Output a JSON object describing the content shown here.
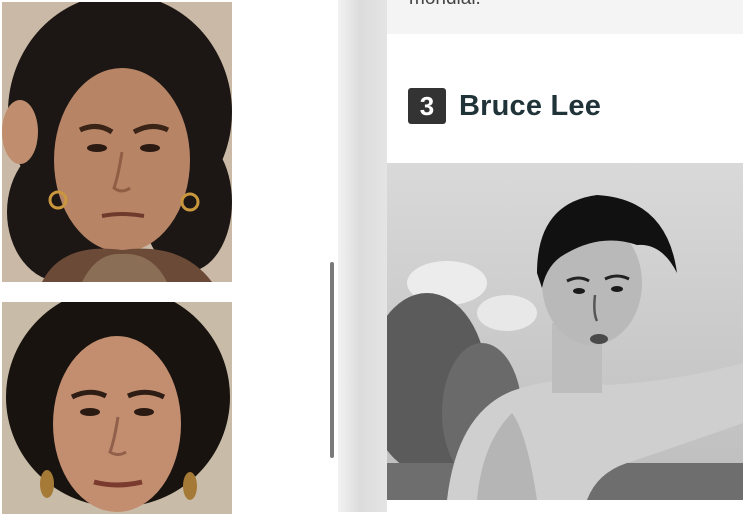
{
  "left_column": {
    "photos": [
      {
        "icon": "portrait-woman-curly-hair-photo"
      },
      {
        "icon": "portrait-woman-dark-hair-photo"
      }
    ]
  },
  "article": {
    "previous_text_fragment": "mondial.",
    "entry": {
      "rank": "3",
      "title": "Bruce Lee",
      "photo_icon": "bruce-lee-black-and-white-photo"
    }
  },
  "colors": {
    "badge": "#333333",
    "title": "#1f3338",
    "gutter": "#dcdcdc"
  }
}
